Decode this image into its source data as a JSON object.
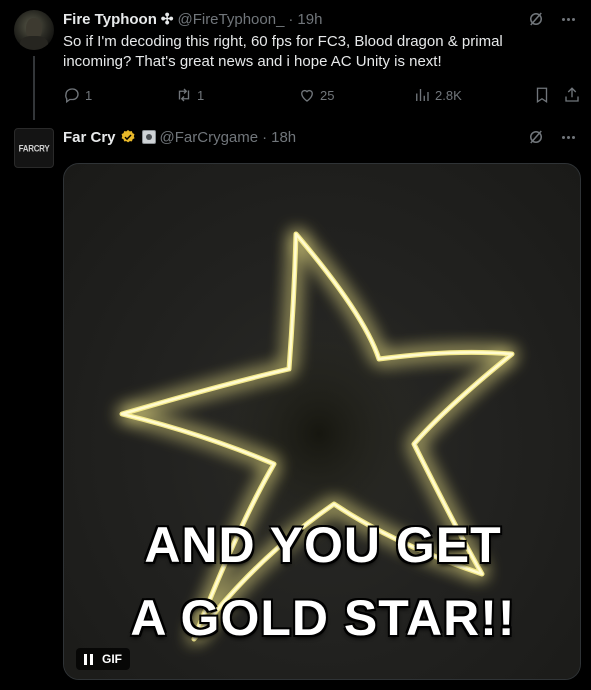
{
  "tweet1": {
    "name": "Fire Typhoon",
    "name_symbol": "✣",
    "handle": "@FireTyphoon_",
    "separator": "·",
    "time": "19h",
    "text": "So if I'm decoding this right, 60 fps for FC3, Blood dragon & primal incoming? That's great news and i hope AC Unity is next!",
    "replies": "1",
    "reposts": "1",
    "likes": "25",
    "views": "2.8K"
  },
  "tweet2": {
    "name": "Far Cry",
    "handle": "@FarCrygame",
    "separator": "·",
    "time": "18h",
    "avatar_text": "FARCRY",
    "media": {
      "caption_line1": "AND YOU GET",
      "caption_line2": "A GOLD STAR!!",
      "badge_label": "GIF"
    }
  },
  "colors": {
    "background": "#000000",
    "text": "#e7e9ea",
    "muted": "#71767b",
    "verified_gold": "#e8b829",
    "star_glow": "#f4e98a"
  },
  "icons": [
    "grok-icon",
    "more-icon",
    "reply-icon",
    "repost-icon",
    "like-icon",
    "views-icon",
    "bookmark-icon",
    "share-icon",
    "verified-badge-icon",
    "affiliate-badge-icon",
    "pause-icon"
  ]
}
